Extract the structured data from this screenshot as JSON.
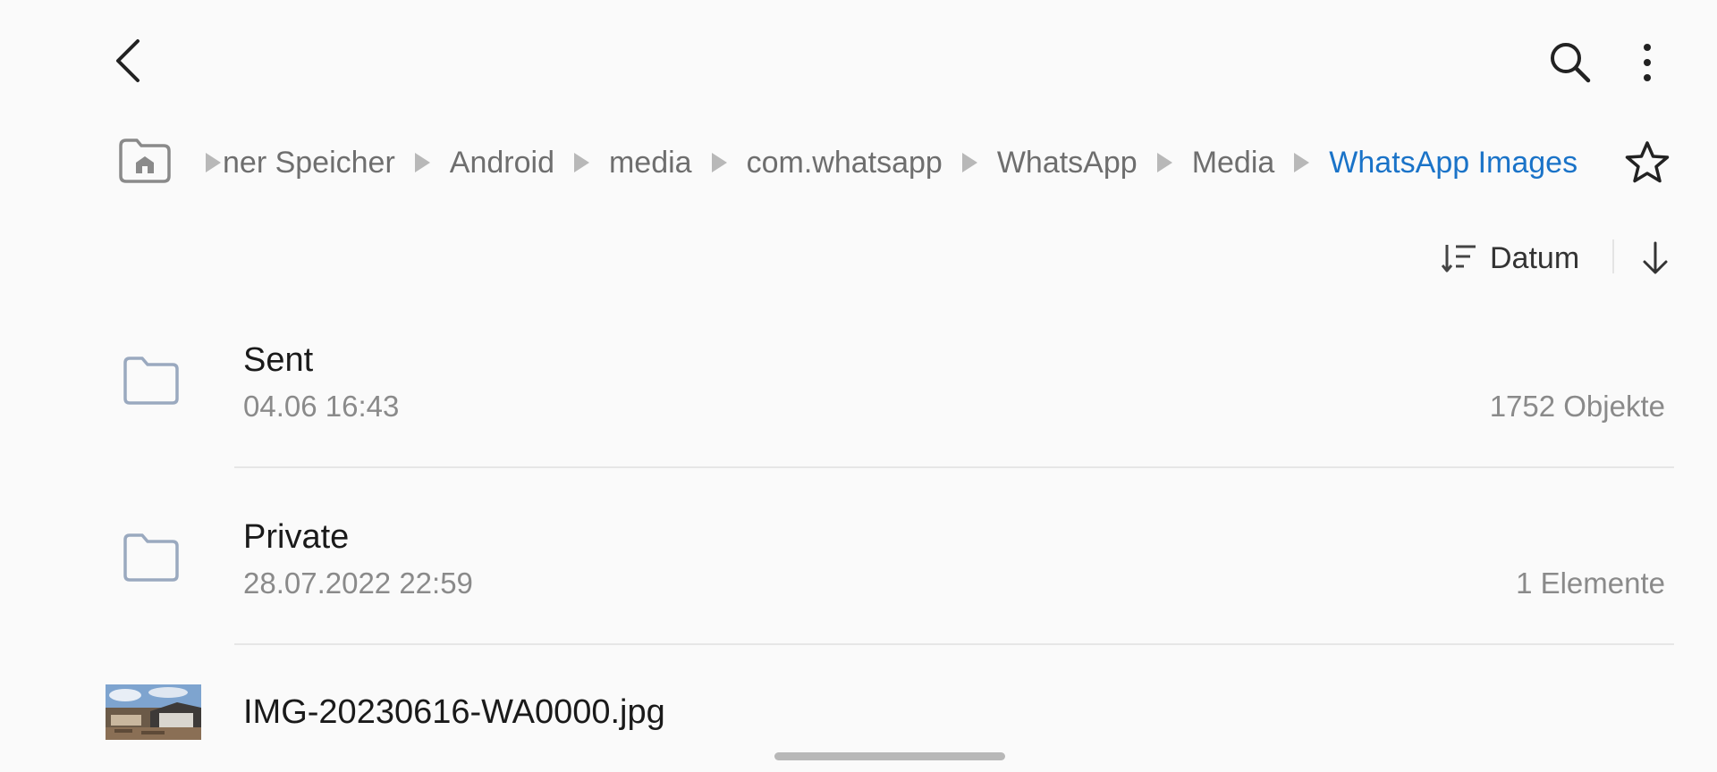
{
  "breadcrumb": {
    "items": [
      "▸ner Speicher",
      "Android",
      "media",
      "com.whatsapp",
      "WhatsApp",
      "Media",
      "WhatsApp Images"
    ],
    "clipped_first": "ner Speicher"
  },
  "sort": {
    "label": "Datum"
  },
  "files": [
    {
      "name": "Sent",
      "date": "04.06 16:43",
      "count": "1752 Objekte",
      "type": "folder"
    },
    {
      "name": "Private",
      "date": "28.07.2022 22:59",
      "count": "1 Elemente",
      "type": "folder"
    },
    {
      "name": "IMG-20230616-WA0000.jpg",
      "type": "image"
    }
  ],
  "colors": {
    "accent": "#1a73c8",
    "background": "#fafafa",
    "secondary_text": "#8a8a8a",
    "folder_icon": "#9aa9bf"
  },
  "icons": {
    "back": "chevron-left-icon",
    "search": "search-icon",
    "more": "more-vert-icon",
    "home": "home-folder-icon",
    "favorite": "star-outline-icon",
    "sort": "sort-icon",
    "sort_direction": "arrow-down-icon"
  }
}
